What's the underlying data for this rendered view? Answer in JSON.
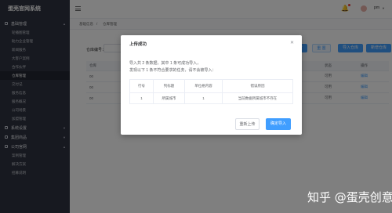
{
  "app": {
    "title": "蛋壳官网系统"
  },
  "sidebar": {
    "sections": [
      {
        "label": "基础管理",
        "items": [
          {
            "label": "轮播图管理",
            "active": false
          },
          {
            "label": "助力企业管理",
            "active": false
          },
          {
            "label": "新闻服务",
            "active": false
          },
          {
            "label": "大客户案例",
            "active": false
          },
          {
            "label": "合作伙伴",
            "active": false
          },
          {
            "label": "仓库管理",
            "active": true
          },
          {
            "label": "交付记",
            "active": false
          },
          {
            "label": "服务信息",
            "active": false
          },
          {
            "label": "服务概况",
            "active": false
          },
          {
            "label": "公司场景",
            "active": false
          },
          {
            "label": "加盟管理",
            "active": false
          }
        ]
      },
      {
        "label": "系统设置",
        "items": []
      },
      {
        "label": "集团商品",
        "items": []
      },
      {
        "label": "公司官网",
        "items": [
          {
            "label": "案例管理",
            "active": false
          },
          {
            "label": "解决方案",
            "active": false
          },
          {
            "label": "招募说明",
            "active": false
          }
        ]
      }
    ]
  },
  "header": {
    "username": "pm",
    "bell": "bell-icon"
  },
  "breadcrumb": [
    "基础信息",
    "/",
    "仓库管理"
  ],
  "filters": {
    "warehouse_label": "仓库编号："
  },
  "toolbar": {
    "search": "搜 索",
    "reset": "重 置",
    "import": "导入仓库",
    "add": "新增仓库"
  },
  "table": {
    "headers": [
      "仓库",
      "状态",
      "操作"
    ],
    "rows": [
      {
        "code": "00",
        "status": "可用",
        "op": "编辑"
      },
      {
        "code": "00",
        "status": "可用",
        "op": "编辑"
      },
      {
        "code": "00",
        "status": "可用",
        "op": "编辑"
      }
    ]
  },
  "modal": {
    "title": "上传成功",
    "line1": "导入共 2 条数据，其中 1 条可成功导入，",
    "line2": "发现以下 1 条不符合要求的任务，请不会被导入：",
    "table": {
      "headers": [
        "行号",
        "列标题",
        "单位格内容",
        "错误原因"
      ],
      "rows": [
        [
          "1",
          "所属城市",
          "1",
          "当前数据所属城市不存在"
        ]
      ]
    },
    "reupload": "重新上传",
    "confirm": "确定导入"
  },
  "watermark": "知乎 @蛋壳创意",
  "colors": {
    "primary": "#409eff",
    "sidebar": "#2f3340"
  }
}
